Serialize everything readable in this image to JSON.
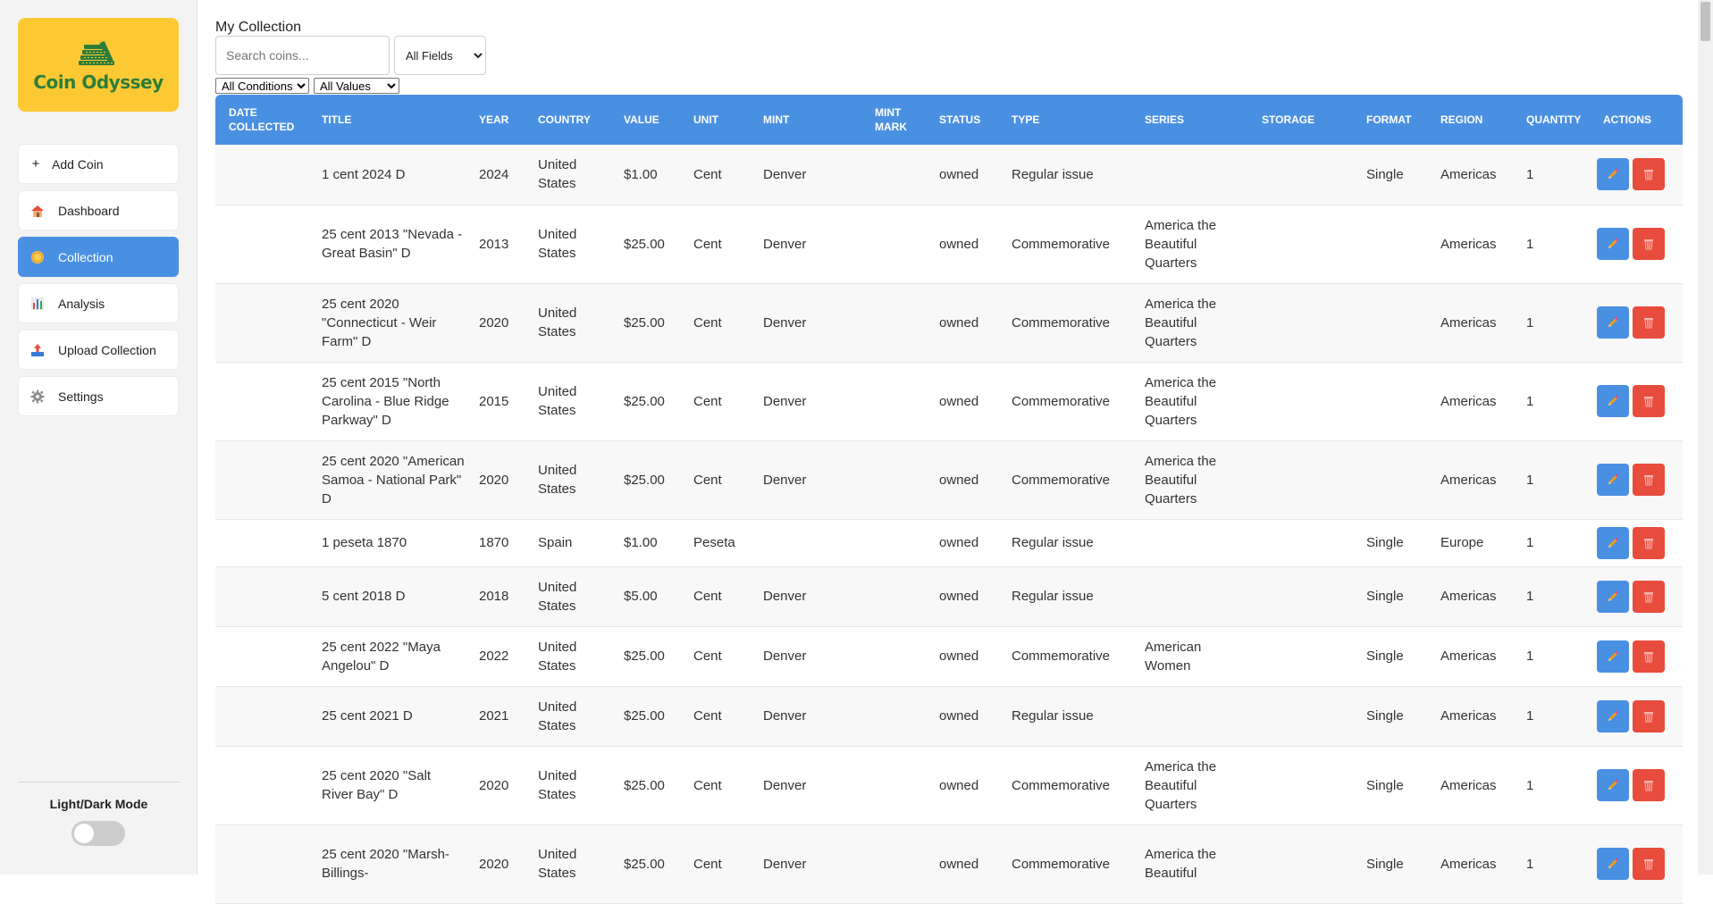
{
  "brand": {
    "name": "Coin Odyssey",
    "bg_color": "#fdc933",
    "text_color": "#2d7d3a"
  },
  "sidebar": {
    "items": [
      {
        "label": "Add Coin",
        "icon": "plus-icon"
      },
      {
        "label": "Dashboard",
        "icon": "house-icon"
      },
      {
        "label": "Collection",
        "icon": "coin-icon",
        "active": true
      },
      {
        "label": "Analysis",
        "icon": "bar-chart-icon"
      },
      {
        "label": "Upload Collection",
        "icon": "upload-tray-icon"
      },
      {
        "label": "Settings",
        "icon": "gear-icon"
      }
    ],
    "mode_label": "Light/Dark Mode",
    "dark_mode": false
  },
  "page": {
    "title": "My Collection",
    "search_placeholder": "Search coins...",
    "field_filter": "All Fields",
    "condition_filter": "All Conditions",
    "value_filter": "All Values"
  },
  "colors": {
    "accent": "#4a90e2",
    "danger": "#e74c3c"
  },
  "table": {
    "columns": [
      "DATE COLLECTED",
      "TITLE",
      "YEAR",
      "COUNTRY",
      "VALUE",
      "UNIT",
      "MINT",
      "MINT MARK",
      "STATUS",
      "TYPE",
      "SERIES",
      "STORAGE",
      "FORMAT",
      "REGION",
      "QUANTITY",
      "ACTIONS"
    ],
    "rows": [
      {
        "date": "",
        "title": "1 cent 2024 D",
        "year": "2024",
        "country": "United States",
        "value": "$1.00",
        "unit": "Cent",
        "mint": "Denver",
        "mint_mark": "",
        "status": "owned",
        "type": "Regular issue",
        "series": "",
        "storage": "",
        "format": "Single",
        "region": "Americas",
        "quantity": "1"
      },
      {
        "date": "",
        "title": "25 cent 2013 \"Nevada - Great Basin\" D",
        "year": "2013",
        "country": "United States",
        "value": "$25.00",
        "unit": "Cent",
        "mint": "Denver",
        "mint_mark": "",
        "status": "owned",
        "type": "Commemorative",
        "series": "America the Beautiful Quarters",
        "storage": "",
        "format": "",
        "region": "Americas",
        "quantity": "1"
      },
      {
        "date": "",
        "title": "25 cent 2020 \"Connecticut - Weir Farm\" D",
        "year": "2020",
        "country": "United States",
        "value": "$25.00",
        "unit": "Cent",
        "mint": "Denver",
        "mint_mark": "",
        "status": "owned",
        "type": "Commemorative",
        "series": "America the Beautiful Quarters",
        "storage": "",
        "format": "",
        "region": "Americas",
        "quantity": "1"
      },
      {
        "date": "",
        "title": "25 cent 2015 \"North Carolina - Blue Ridge Parkway\" D",
        "year": "2015",
        "country": "United States",
        "value": "$25.00",
        "unit": "Cent",
        "mint": "Denver",
        "mint_mark": "",
        "status": "owned",
        "type": "Commemorative",
        "series": "America the Beautiful Quarters",
        "storage": "",
        "format": "",
        "region": "Americas",
        "quantity": "1"
      },
      {
        "date": "",
        "title": "25 cent 2020 \"American Samoa - National Park\" D",
        "year": "2020",
        "country": "United States",
        "value": "$25.00",
        "unit": "Cent",
        "mint": "Denver",
        "mint_mark": "",
        "status": "owned",
        "type": "Commemorative",
        "series": "America the Beautiful Quarters",
        "storage": "",
        "format": "",
        "region": "Americas",
        "quantity": "1"
      },
      {
        "date": "",
        "title": "1 peseta 1870",
        "year": "1870",
        "country": "Spain",
        "value": "$1.00",
        "unit": "Peseta",
        "mint": "",
        "mint_mark": "",
        "status": "owned",
        "type": "Regular issue",
        "series": "",
        "storage": "",
        "format": "Single",
        "region": "Europe",
        "quantity": "1"
      },
      {
        "date": "",
        "title": "5 cent 2018 D",
        "year": "2018",
        "country": "United States",
        "value": "$5.00",
        "unit": "Cent",
        "mint": "Denver",
        "mint_mark": "",
        "status": "owned",
        "type": "Regular issue",
        "series": "",
        "storage": "",
        "format": "Single",
        "region": "Americas",
        "quantity": "1"
      },
      {
        "date": "",
        "title": "25 cent 2022 \"Maya Angelou\" D",
        "year": "2022",
        "country": "United States",
        "value": "$25.00",
        "unit": "Cent",
        "mint": "Denver",
        "mint_mark": "",
        "status": "owned",
        "type": "Commemorative",
        "series": "American Women",
        "storage": "",
        "format": "Single",
        "region": "Americas",
        "quantity": "1"
      },
      {
        "date": "",
        "title": "25 cent 2021 D",
        "year": "2021",
        "country": "United States",
        "value": "$25.00",
        "unit": "Cent",
        "mint": "Denver",
        "mint_mark": "",
        "status": "owned",
        "type": "Regular issue",
        "series": "",
        "storage": "",
        "format": "Single",
        "region": "Americas",
        "quantity": "1"
      },
      {
        "date": "",
        "title": "25 cent 2020 \"Salt River Bay\" D",
        "year": "2020",
        "country": "United States",
        "value": "$25.00",
        "unit": "Cent",
        "mint": "Denver",
        "mint_mark": "",
        "status": "owned",
        "type": "Commemorative",
        "series": "America the Beautiful Quarters",
        "storage": "",
        "format": "Single",
        "region": "Americas",
        "quantity": "1"
      },
      {
        "date": "",
        "title": "25 cent 2020 \"Marsh-Billings-",
        "year": "2020",
        "country": "United States",
        "value": "$25.00",
        "unit": "Cent",
        "mint": "Denver",
        "mint_mark": "",
        "status": "owned",
        "type": "Commemorative",
        "series": "America the Beautiful",
        "storage": "",
        "format": "Single",
        "region": "Americas",
        "quantity": "1"
      }
    ]
  }
}
